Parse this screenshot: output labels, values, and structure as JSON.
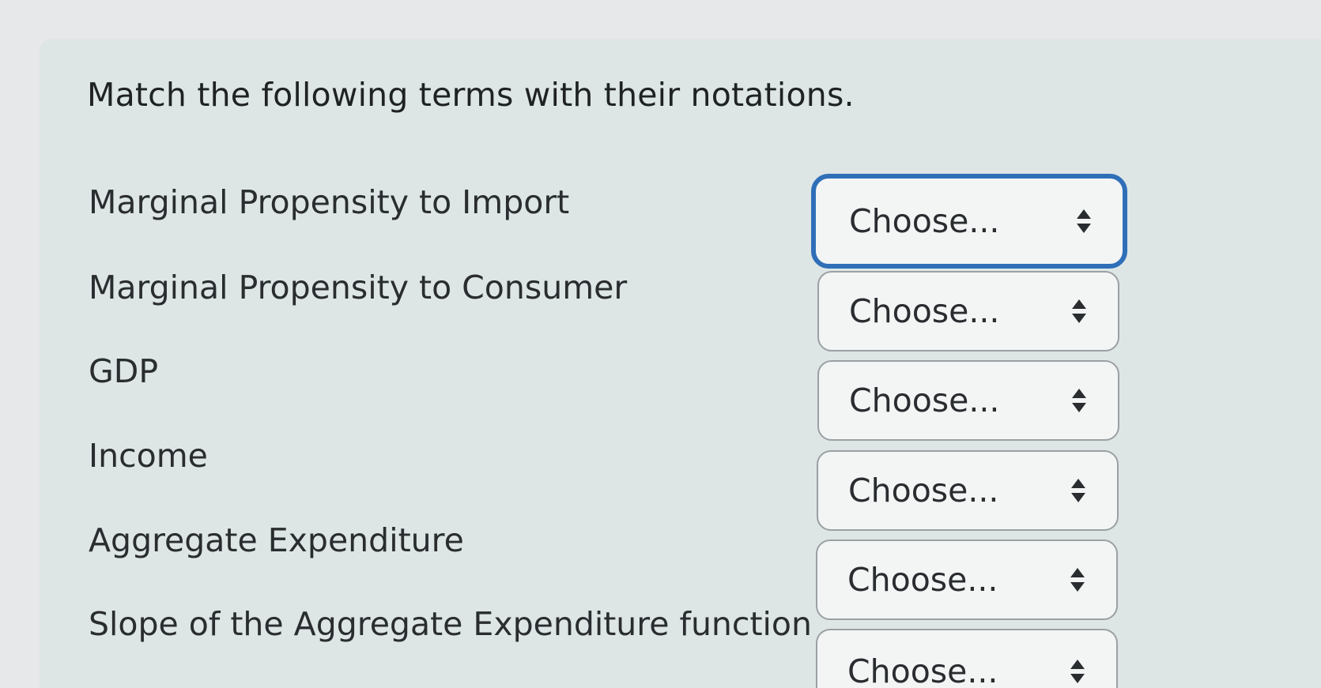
{
  "prompt": "Match the following terms with their notations.",
  "rows": [
    {
      "term": "Marginal Propensity to Import",
      "select_value": "Choose..."
    },
    {
      "term": "Marginal Propensity to Consumer",
      "select_value": "Choose..."
    },
    {
      "term": "GDP",
      "select_value": "Choose..."
    },
    {
      "term": "Income",
      "select_value": "Choose..."
    },
    {
      "term": "Aggregate Expenditure",
      "select_value": "Choose..."
    },
    {
      "term": "Slope of the Aggregate Expenditure function",
      "select_value": "Choose..."
    }
  ],
  "icons": {
    "select_arrows": "updown-chevron-icon"
  },
  "colors": {
    "focus_border": "#2f6fb8",
    "select_border": "#9aa0a3",
    "panel_background": "#dde6e5"
  }
}
